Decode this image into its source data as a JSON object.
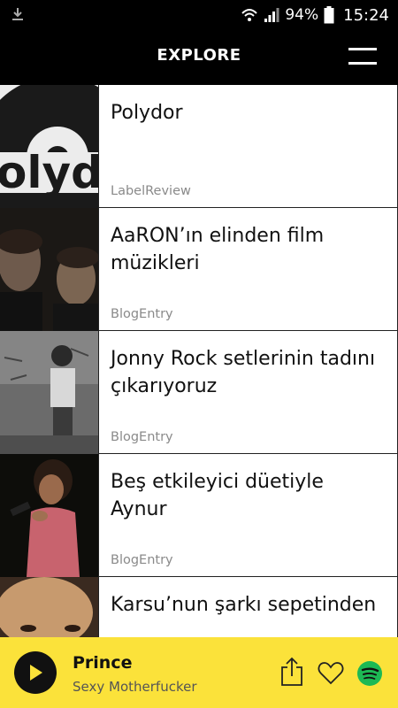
{
  "status_bar": {
    "battery_percent": "94%",
    "time": "15:24",
    "icons": [
      "download-icon",
      "wifi-icon",
      "signal-icon",
      "battery-icon"
    ]
  },
  "header": {
    "title": "EXPLORE",
    "menu_icon": "hamburger-menu-icon"
  },
  "feed": {
    "items": [
      {
        "title": "Polydor",
        "type": "LabelReview"
      },
      {
        "title": "AaRON’ın elinden film müzikleri",
        "type": "BlogEntry"
      },
      {
        "title": "Jonny Rock setlerinin tadını çıkarıyoruz",
        "type": "BlogEntry"
      },
      {
        "title": "Beş etkileyici düetiyle Aynur",
        "type": "BlogEntry"
      },
      {
        "title": "Karsu’nun şarkı sepetinden",
        "type": ""
      }
    ]
  },
  "player": {
    "track_title": "Prince",
    "track_subtitle": "Sexy Motherfucker",
    "background_color": "#fbe23a",
    "icons": [
      "play-icon",
      "share-icon",
      "heart-icon",
      "spotify-icon"
    ]
  }
}
